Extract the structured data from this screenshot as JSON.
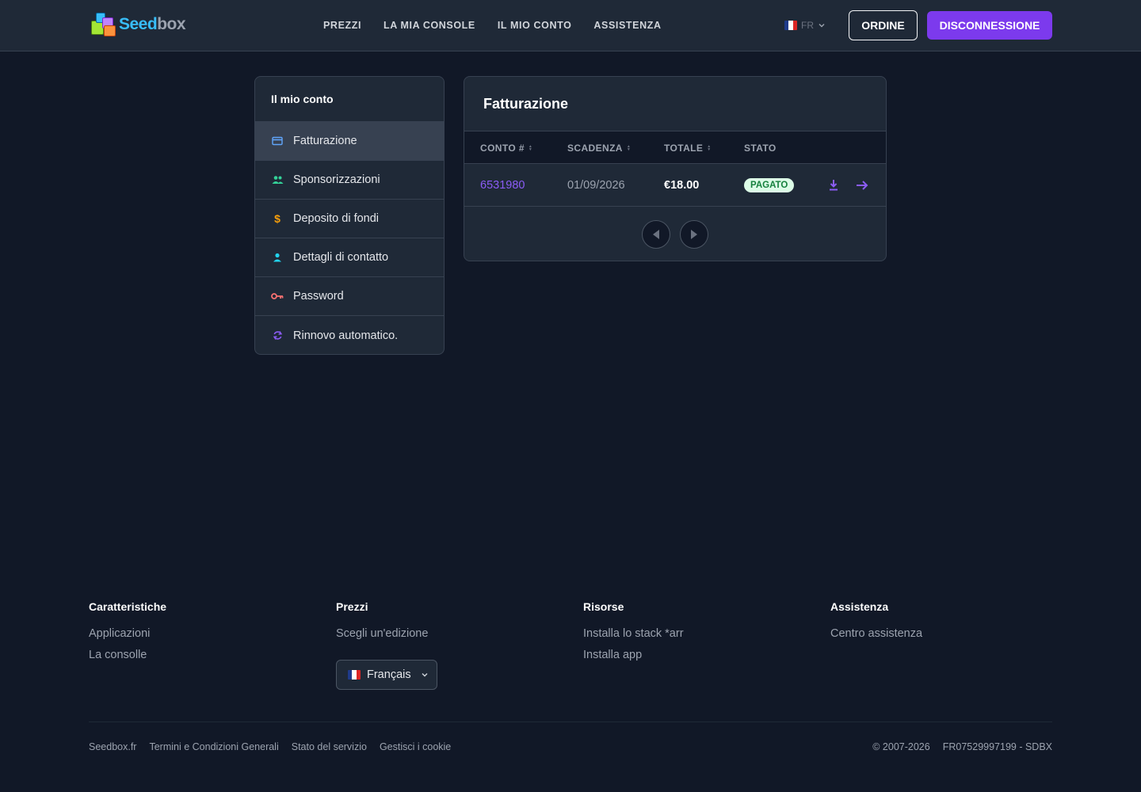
{
  "header": {
    "logo": {
      "part1": "Seed",
      "part2": "box"
    },
    "nav": [
      "PREZZI",
      "LA MIA CONSOLE",
      "IL MIO CONTO",
      "ASSISTENZA"
    ],
    "lang_code": "FR",
    "order_label": "ORDINE",
    "logout_label": "DISCONNESSIONE"
  },
  "sidebar": {
    "title": "Il mio conto",
    "items": [
      {
        "label": "Fatturazione",
        "icon": "credit-card-icon"
      },
      {
        "label": "Sponsorizzazioni",
        "icon": "users-icon"
      },
      {
        "label": "Deposito di fondi",
        "icon": "dollar-icon"
      },
      {
        "label": "Dettagli di contatto",
        "icon": "user-icon"
      },
      {
        "label": "Password",
        "icon": "key-icon"
      },
      {
        "label": "Rinnovo automatico.",
        "icon": "refresh-icon"
      }
    ]
  },
  "billing": {
    "title": "Fatturazione",
    "columns": [
      "CONTO #",
      "SCADENZA",
      "TOTALE",
      "STATO"
    ],
    "rows": [
      {
        "account": "6531980",
        "due": "01/09/2026",
        "total": "€18.00",
        "status": "PAGATO"
      }
    ]
  },
  "footer": {
    "columns": [
      {
        "title": "Caratteristiche",
        "links": [
          "Applicazioni",
          "La consolle"
        ]
      },
      {
        "title": "Prezzi",
        "links": [
          "Scegli un'edizione"
        ]
      },
      {
        "title": "Risorse",
        "links": [
          "Installa lo stack *arr",
          "Installa app"
        ]
      },
      {
        "title": "Assistenza",
        "links": [
          "Centro assistenza"
        ]
      }
    ],
    "language": "Français",
    "bottom_links": [
      "Seedbox.fr",
      "Termini e Condizioni Generali",
      "Stato del servizio",
      "Gestisci i cookie"
    ],
    "copyright": "© 2007-2026",
    "company_id": "FR07529997199 - SDBX"
  },
  "colors": {
    "accent": "#7c3aed",
    "background": "#111827",
    "panel": "#1f2937",
    "paid_badge_bg": "#dcfce7",
    "paid_badge_text": "#15803d"
  }
}
